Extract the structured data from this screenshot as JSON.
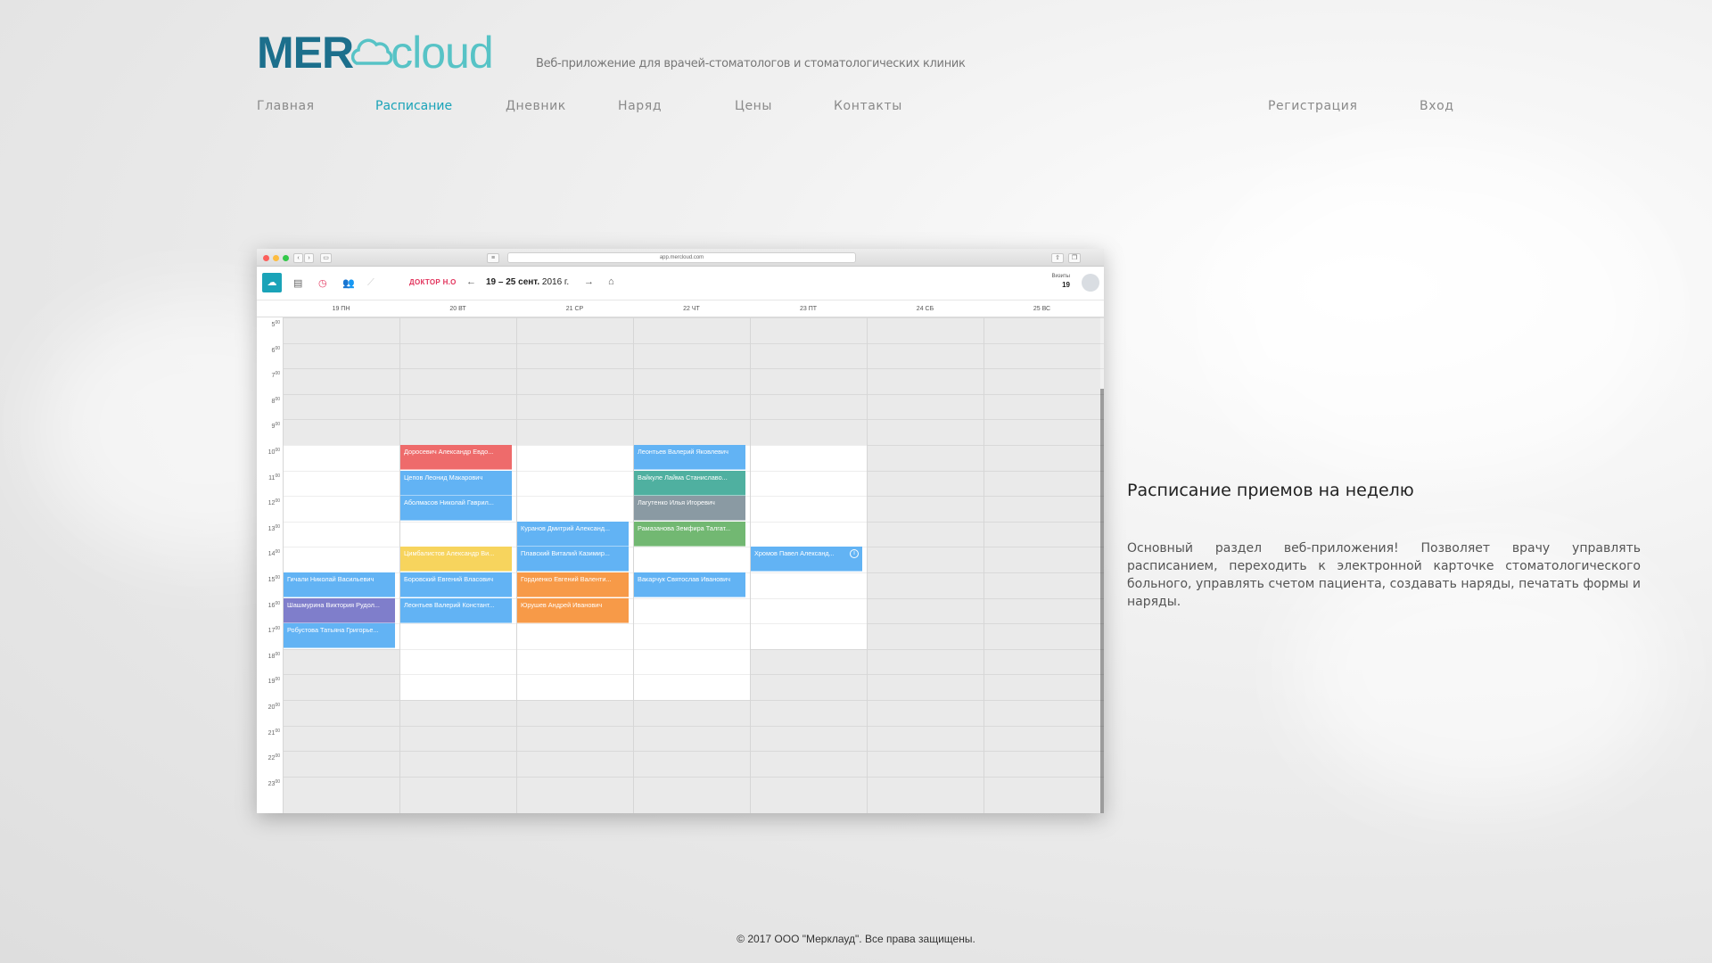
{
  "header": {
    "logo_mer": "MER",
    "logo_cloud": "cloud",
    "tagline": "Веб-приложение для врачей-стоматологов и стоматологических клиник",
    "brand_colors": {
      "dark": "#1c6f8c",
      "light": "#57c3c6",
      "accent": "#1aa3b8"
    }
  },
  "nav": {
    "items": [
      {
        "label": "Главная",
        "active": false
      },
      {
        "label": "Расписание",
        "active": true
      },
      {
        "label": "Дневник",
        "active": false
      },
      {
        "label": "Наряд",
        "active": false
      },
      {
        "label": "Цены",
        "active": false
      },
      {
        "label": "Контакты",
        "active": false
      }
    ],
    "register": "Регистрация",
    "login": "Вход"
  },
  "app_screenshot": {
    "url": "app.mercloud.com",
    "doctor": "ДОКТОР Н.О",
    "range_bold": "19 – 25 сент.",
    "range_year": "2016 г.",
    "visits_label": "Визиты",
    "visits_count": "19",
    "days": [
      "19 ПН",
      "20 ВТ",
      "21 СР",
      "22 ЧТ",
      "23 ПТ",
      "24 СБ",
      "25 ВС"
    ],
    "hours": [
      "5",
      "6",
      "7",
      "8",
      "9",
      "10",
      "11",
      "12",
      "13",
      "14",
      "15",
      "16",
      "17",
      "18",
      "19",
      "20",
      "21",
      "22",
      "23"
    ],
    "hour_suffix": "00",
    "appointments": [
      {
        "day": 1,
        "hour": 10,
        "name": "Доросевич Александр Евдо...",
        "color": "#ee6b6b"
      },
      {
        "day": 1,
        "hour": 11,
        "name": "Цепов Леонид Макарович",
        "color": "#62b3f4"
      },
      {
        "day": 1,
        "hour": 12,
        "name": "Аболмасов Николай Гаврил...",
        "color": "#62b3f4"
      },
      {
        "day": 1,
        "hour": 14,
        "name": "Цимбалистов Александр Ви...",
        "color": "#f7d45d"
      },
      {
        "day": 1,
        "hour": 15,
        "name": "Боровский Евгений Власович",
        "color": "#62b3f4"
      },
      {
        "day": 1,
        "hour": 16,
        "name": "Леонтьев Валерий Констант...",
        "color": "#62b3f4"
      },
      {
        "day": 0,
        "hour": 15,
        "name": "Гичали Николай Васильевич",
        "color": "#62b3f4"
      },
      {
        "day": 0,
        "hour": 16,
        "name": "Шашмурина Виктория Рудол...",
        "color": "#7f7ecb"
      },
      {
        "day": 0,
        "hour": 17,
        "name": "Робустова Татьяна Григорье...",
        "color": "#62b3f4"
      },
      {
        "day": 2,
        "hour": 13,
        "name": "Куранов Дмитрий Александ...",
        "color": "#62b3f4"
      },
      {
        "day": 2,
        "hour": 14,
        "name": "Плавский Виталий Казимир...",
        "color": "#62b3f4"
      },
      {
        "day": 2,
        "hour": 15,
        "name": "Гордиенко Евгений Валенти...",
        "color": "#f79a48"
      },
      {
        "day": 2,
        "hour": 16,
        "name": "Юрушев Андрей Иванович",
        "color": "#f79a48"
      },
      {
        "day": 3,
        "hour": 10,
        "name": "Леонтьев Валерий Яковлевич",
        "color": "#62b3f4"
      },
      {
        "day": 3,
        "hour": 11,
        "name": "Вайкуле Лайма Станиславо...",
        "color": "#4fb0a0"
      },
      {
        "day": 3,
        "hour": 12,
        "name": "Лагутенко Илья Игоревич",
        "color": "#8a9aa3"
      },
      {
        "day": 3,
        "hour": 13,
        "name": "Рамазанова Земфира Талгат...",
        "color": "#72b872"
      },
      {
        "day": 3,
        "hour": 15,
        "name": "Вакарчук Святослав Иванович",
        "color": "#62b3f4"
      },
      {
        "day": 4,
        "hour": 14,
        "name": "Хромов Павел Александ...",
        "color": "#62b3f4",
        "info": true
      }
    ]
  },
  "feature": {
    "title": "Расписание приемов на неделю",
    "description": "Основный раздел веб-приложения! Позволяет врачу управлять расписанием, переходить к электронной карточке стоматологического больного, управлять счетом пациента, создавать наряды, печатать формы и наряды."
  },
  "footer": {
    "copyright": "© 2017 ООО \"Мерклауд\". Все права защищены."
  }
}
